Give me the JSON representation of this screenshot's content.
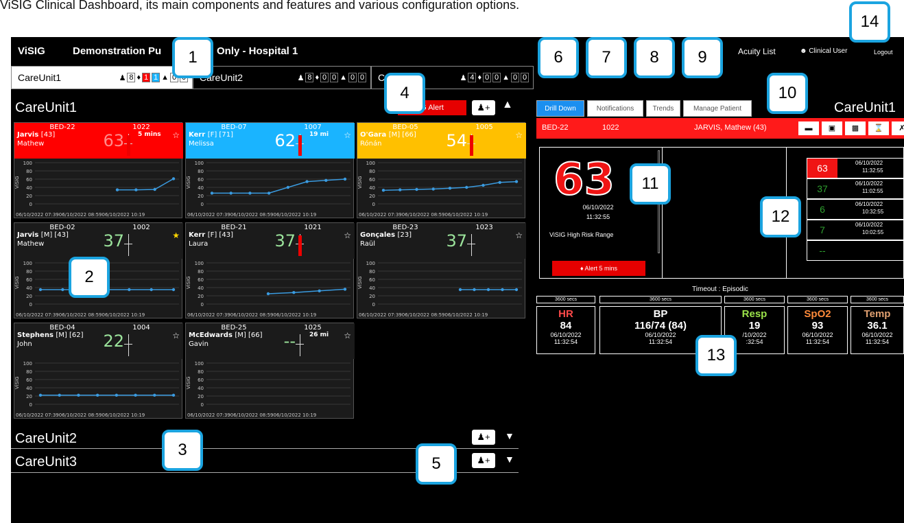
{
  "caption": "ViSIG Clinical Dashboard, its main components and features and various configuration options.",
  "topbar": {
    "logo": "ViSIG",
    "title": "Demonstration Pu",
    "title2": "Only - Hospital 1",
    "acuity": "Acuity List",
    "user": "Clinical User",
    "logout": "Logout"
  },
  "unit_tabs": [
    {
      "label": "CareUnit1",
      "patients": "8",
      "alerts": "1",
      "warn": "1",
      "a1": "0",
      "a2": "0"
    },
    {
      "label": "CareUnit2",
      "patients": "8",
      "alerts": "0",
      "warn": "0",
      "a1": "0",
      "a2": "0"
    },
    {
      "label": "C",
      "patients": "4",
      "alerts": "0",
      "warn": "0",
      "a1": "0",
      "a2": "0"
    }
  ],
  "units": {
    "u1": "CareUnit1",
    "u2": "CareUnit2",
    "u3": "CareUnit3"
  },
  "alert_button": "G Alert",
  "cards": [
    {
      "bed": "BED-22",
      "num": "1022",
      "surname": "Jarvis",
      "info": "[43]",
      "first": "Mathew",
      "score": "63",
      "alert": "5 mins",
      "color": "#ff0000"
    },
    {
      "bed": "BED-07",
      "num": "1007",
      "surname": "Kerr",
      "info": "[F] [71]",
      "first": "Melissa",
      "score": "62",
      "alert": "19 mi",
      "color": "#1ab4ff"
    },
    {
      "bed": "BED-05",
      "num": "1005",
      "surname": "O'Gara",
      "info": "[M] [66]",
      "first": "Rónán",
      "score": "54",
      "alert": "",
      "color": "#ffc000"
    },
    {
      "bed": "BED-02",
      "num": "1002",
      "surname": "Jarvis",
      "info": "[M] [43]",
      "first": "Mathew",
      "score": "37",
      "alert": "",
      "color": ""
    },
    {
      "bed": "BED-21",
      "num": "1021",
      "surname": "Kerr",
      "info": "[F] [43]",
      "first": "Laura",
      "score": "37",
      "alert": "",
      "color": ""
    },
    {
      "bed": "BED-23",
      "num": "1023",
      "surname": "Gonçales",
      "info": "[23]",
      "first": "Raül",
      "score": "37",
      "alert": "",
      "color": ""
    },
    {
      "bed": "BED-04",
      "num": "1004",
      "surname": "Stephens",
      "info": "[M] [62]",
      "first": "John",
      "score": "22",
      "alert": "",
      "color": ""
    },
    {
      "bed": "BED-25",
      "num": "1025",
      "surname": "McEdwards",
      "info": "[M] [66]",
      "first": "Gavin",
      "score": "--",
      "alert": "26 mi",
      "color": ""
    }
  ],
  "plot_labels": {
    "y": [
      "100",
      "80",
      "60",
      "40",
      "20",
      "0"
    ],
    "axis": "ViSIG",
    "x": "06/10/2022 07:3906/10/2022 08:5906/10/2022 10:19"
  },
  "rtabs": [
    "Drill Down",
    "Notifications",
    "Trends",
    "Manage Patient"
  ],
  "rtitle": "CareUnit1",
  "patient_bar": {
    "bed": "BED-22",
    "num": "1022",
    "name": "JARVIS, Mathew (43)"
  },
  "detail": {
    "score": "63",
    "date": "06/10/2022",
    "time": "11:32:55",
    "range": "ViSIG High Risk Range",
    "alert": "Alert 5 mins"
  },
  "history": [
    {
      "v": "63",
      "d": "06/10/2022",
      "t": "11:32:55"
    },
    {
      "v": "37",
      "d": "06/10/2022",
      "t": "11:02:55"
    },
    {
      "v": "6",
      "d": "06/10/2022",
      "t": "10:32:55"
    },
    {
      "v": "7",
      "d": "06/10/2022",
      "t": "10:02:55"
    },
    {
      "v": "--",
      "d": "",
      "t": ""
    }
  ],
  "timeout": "Timeout : Episodic",
  "secs": "3600 secs",
  "vitals": [
    {
      "l": "HR",
      "v": "84",
      "d": "06/10/2022",
      "t": "11:32:54",
      "c": "#ff4a4a"
    },
    {
      "l": "BP",
      "v": "116/74 (84)",
      "d": "06/10/2022",
      "t": "11:32:54",
      "c": "#fff"
    },
    {
      "l": "Resp",
      "v": "19",
      "d": "/10/2022",
      "t": ":32:54",
      "c": "#9be34a"
    },
    {
      "l": "SpO2",
      "v": "93",
      "d": "06/10/2022",
      "t": "11:32:54",
      "c": "#ff8a3a"
    },
    {
      "l": "Temp",
      "v": "36.1",
      "d": "06/10/2022",
      "t": "11:32:54",
      "c": "#e0a070"
    }
  ],
  "badges": [
    "1",
    "2",
    "3",
    "4",
    "5",
    "6",
    "7",
    "8",
    "9",
    "10",
    "11",
    "12",
    "13",
    "14"
  ]
}
